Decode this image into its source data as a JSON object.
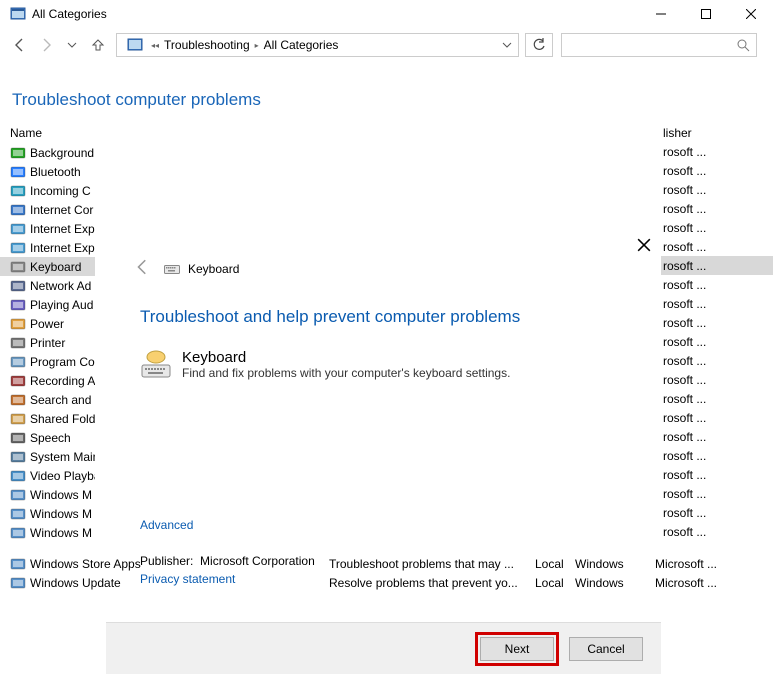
{
  "window": {
    "title": "All Categories"
  },
  "address": {
    "root": "Troubleshooting",
    "leaf": "All Categories"
  },
  "heading": "Troubleshoot computer problems",
  "columns": {
    "name": "Name",
    "publisher": "lisher"
  },
  "items": [
    {
      "label": "Background",
      "pub": "rosoft ..."
    },
    {
      "label": "Bluetooth",
      "pub": "rosoft ..."
    },
    {
      "label": "Incoming C",
      "pub": "rosoft ..."
    },
    {
      "label": "Internet Cor",
      "pub": "rosoft ..."
    },
    {
      "label": "Internet Exp",
      "pub": "rosoft ..."
    },
    {
      "label": "Internet Exp",
      "pub": "rosoft ..."
    },
    {
      "label": "Keyboard",
      "pub": "rosoft ...",
      "selected": true
    },
    {
      "label": "Network Ad",
      "pub": "rosoft ..."
    },
    {
      "label": "Playing Aud",
      "pub": "rosoft ..."
    },
    {
      "label": "Power",
      "pub": "rosoft ..."
    },
    {
      "label": "Printer",
      "pub": "rosoft ..."
    },
    {
      "label": "Program Co",
      "pub": "rosoft ..."
    },
    {
      "label": "Recording A",
      "pub": "rosoft ..."
    },
    {
      "label": "Search and I",
      "pub": "rosoft ..."
    },
    {
      "label": "Shared Folde",
      "pub": "rosoft ..."
    },
    {
      "label": "Speech",
      "pub": "rosoft ..."
    },
    {
      "label": "System Main",
      "pub": "rosoft ..."
    },
    {
      "label": "Video Playba",
      "pub": "rosoft ..."
    },
    {
      "label": "Windows M",
      "pub": "rosoft ..."
    },
    {
      "label": "Windows M",
      "pub": "rosoft ..."
    },
    {
      "label": "Windows M",
      "pub": "rosoft ..."
    }
  ],
  "bottom_rows": [
    {
      "name": "Windows Store Apps",
      "desc": "Troubleshoot problems that may ...",
      "loc": "Local",
      "cat": "Windows",
      "pub": "Microsoft ..."
    },
    {
      "name": "Windows Update",
      "desc": "Resolve problems that prevent yo...",
      "loc": "Local",
      "cat": "Windows",
      "pub": "Microsoft ..."
    }
  ],
  "dialog": {
    "crumb": "Keyboard",
    "title": "Troubleshoot and help prevent computer problems",
    "item_title": "Keyboard",
    "item_desc": "Find and fix problems with your computer's keyboard settings.",
    "advanced": "Advanced",
    "publisher_label": "Publisher:",
    "publisher_value": "Microsoft Corporation",
    "privacy": "Privacy statement",
    "next": "Next",
    "cancel": "Cancel"
  },
  "icon_colors": {
    "Background": "#27a327",
    "Bluetooth": "#2a7fff",
    "Incoming C": "#2aa0c0",
    "Internet Cor": "#3a78c8",
    "Internet Exp": "#4a9cd0",
    "Keyboard": "#888888",
    "Network Ad": "#5a6a90",
    "Playing Aud": "#6a60c0",
    "Power": "#e0a040",
    "Printer": "#777777",
    "Program Co": "#6a98c0",
    "Recording A": "#a04040",
    "Search and I": "#c07030",
    "Shared Folde": "#d0a050",
    "Speech": "#666666",
    "System Main": "#5a80a0",
    "Video Playba": "#4a90c8",
    "Windows M": "#5890c8",
    "Windows Store Apps": "#5890c8",
    "Windows Update": "#5890c8"
  }
}
